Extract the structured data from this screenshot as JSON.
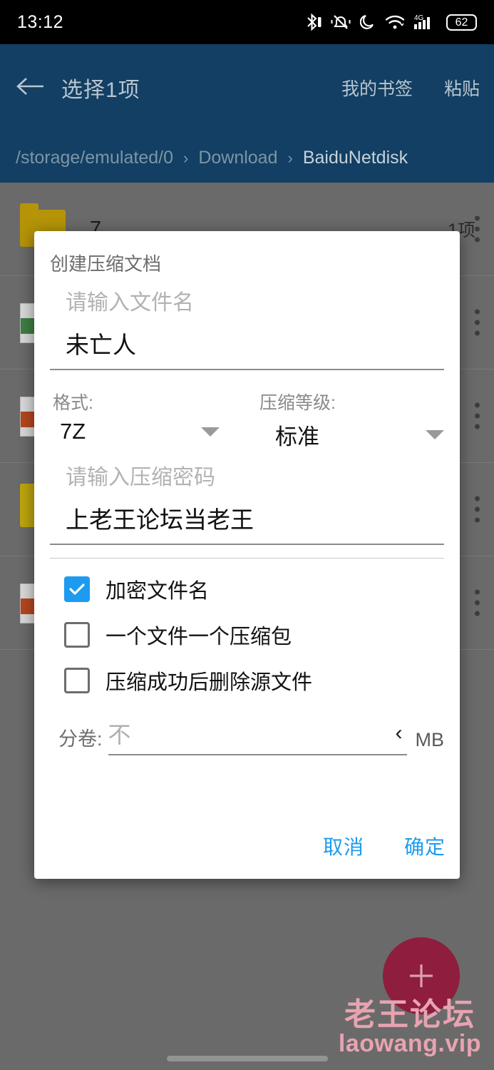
{
  "status_bar": {
    "clock": "13:12",
    "battery": "62",
    "network": "4G",
    "icons": [
      "bluetooth-icon",
      "mute-icon",
      "do-not-disturb-icon",
      "wifi-icon",
      "signal-icon",
      "battery-icon"
    ]
  },
  "app_bar": {
    "back_icon": "arrow-left-icon",
    "title": "选择1项",
    "actions": [
      {
        "label": "我的书签",
        "name": "my-bookmarks"
      },
      {
        "label": "粘贴",
        "name": "paste"
      }
    ],
    "breadcrumb": [
      "/storage/emulated/0",
      "Download",
      "BaiduNetdisk"
    ],
    "breadcrumb_separator": "›",
    "bg_color": "#123f63"
  },
  "file_list": [
    {
      "name": "7",
      "meta": "1项",
      "icon": "folder-icon",
      "color": "#b59408"
    },
    {
      "name": "",
      "meta": "",
      "icon": "file-icon",
      "color": "#3f7d44"
    },
    {
      "name": "",
      "meta": "",
      "icon": "file-icon",
      "color": "#b6461f"
    },
    {
      "name": "",
      "meta": "",
      "icon": "folder-icon",
      "color": "#bda50d"
    },
    {
      "name": "",
      "meta": "",
      "icon": "file-icon",
      "color": "#b6461f"
    }
  ],
  "fab": {
    "icon": "plus-icon",
    "color": "#8e1d3e"
  },
  "watermark": {
    "cn": "老王论坛",
    "en": "laowang.vip",
    "color": "#e8a3b0"
  },
  "dialog": {
    "title": "创建压缩文档",
    "filename": {
      "placeholder": "请输入文件名",
      "value": "未亡人"
    },
    "format": {
      "label": "格式:",
      "value": "7Z"
    },
    "level": {
      "label": "压缩等级:",
      "value": "标准"
    },
    "password": {
      "placeholder": "请输入压缩密码",
      "value": "上老王论坛当老王"
    },
    "checkboxes": [
      {
        "label": "加密文件名",
        "checked": true,
        "name": "encrypt-filenames"
      },
      {
        "label": "一个文件一个压缩包",
        "checked": false,
        "name": "one-archive-per-file"
      },
      {
        "label": "压缩成功后删除源文件",
        "checked": false,
        "name": "delete-source-after"
      }
    ],
    "volume": {
      "label": "分卷:",
      "value": "不",
      "unit": "MB",
      "stepper_icon": "chevron-left-icon"
    },
    "buttons": [
      {
        "label": "取消",
        "name": "cancel"
      },
      {
        "label": "确定",
        "name": "confirm"
      }
    ],
    "accent_color": "#1d9bf0"
  }
}
